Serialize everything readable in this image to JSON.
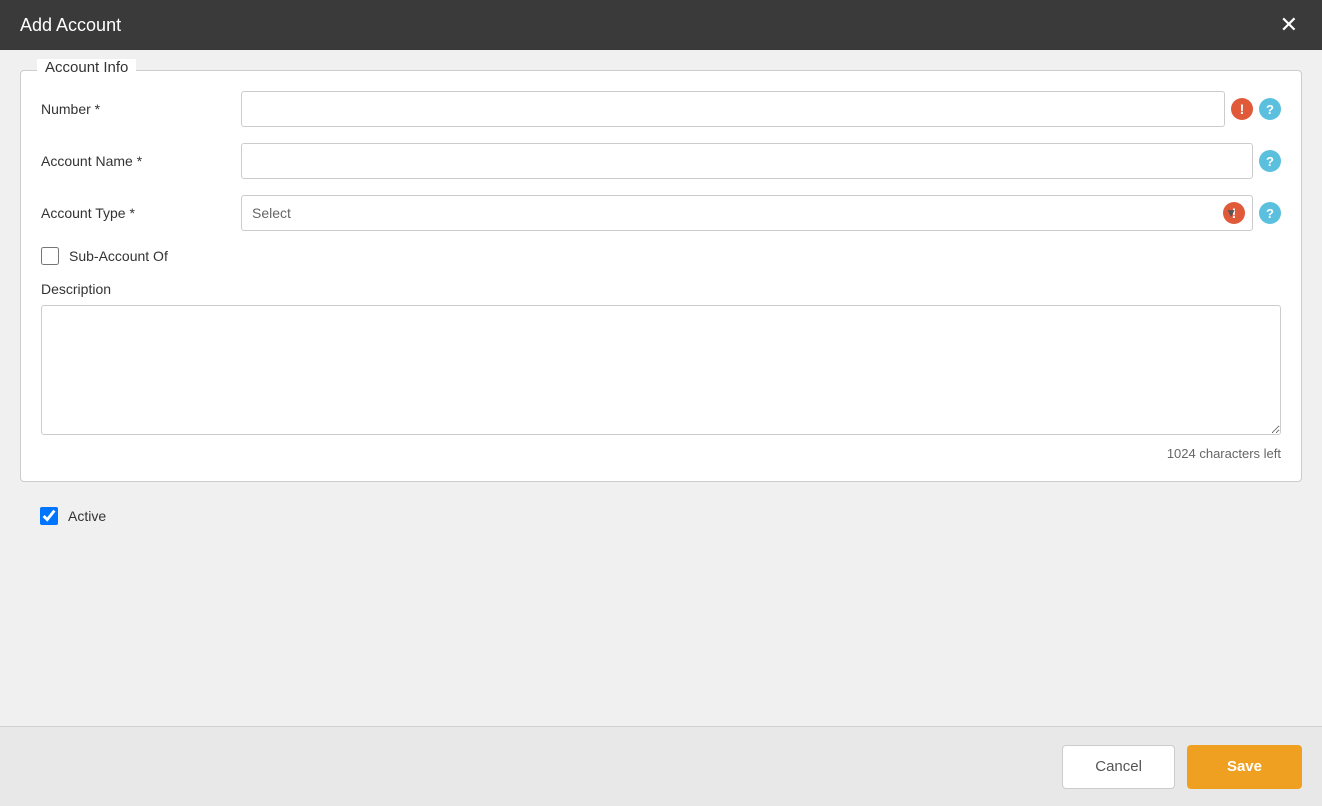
{
  "dialog": {
    "title": "Add Account",
    "close_label": "✕"
  },
  "sections": {
    "account_info": {
      "legend": "Account Info",
      "fields": {
        "number": {
          "label": "Number *",
          "placeholder": "",
          "value": ""
        },
        "account_name": {
          "label": "Account Name *",
          "placeholder": "",
          "value": ""
        },
        "account_type": {
          "label": "Account Type *",
          "placeholder": "Select",
          "value": ""
        }
      },
      "sub_account_label": "Sub-Account Of",
      "description_label": "Description",
      "description_placeholder": "",
      "char_count": "1024 characters left"
    }
  },
  "active_label": "Active",
  "footer": {
    "cancel_label": "Cancel",
    "save_label": "Save"
  },
  "icons": {
    "close": "✕",
    "error": "!",
    "help": "?",
    "arrow_down": "▼"
  },
  "colors": {
    "header_bg": "#3a3a3a",
    "error_icon": "#e05a3a",
    "help_icon": "#5bc0de",
    "save_btn": "#f0a020",
    "accent": "#f0a020"
  }
}
